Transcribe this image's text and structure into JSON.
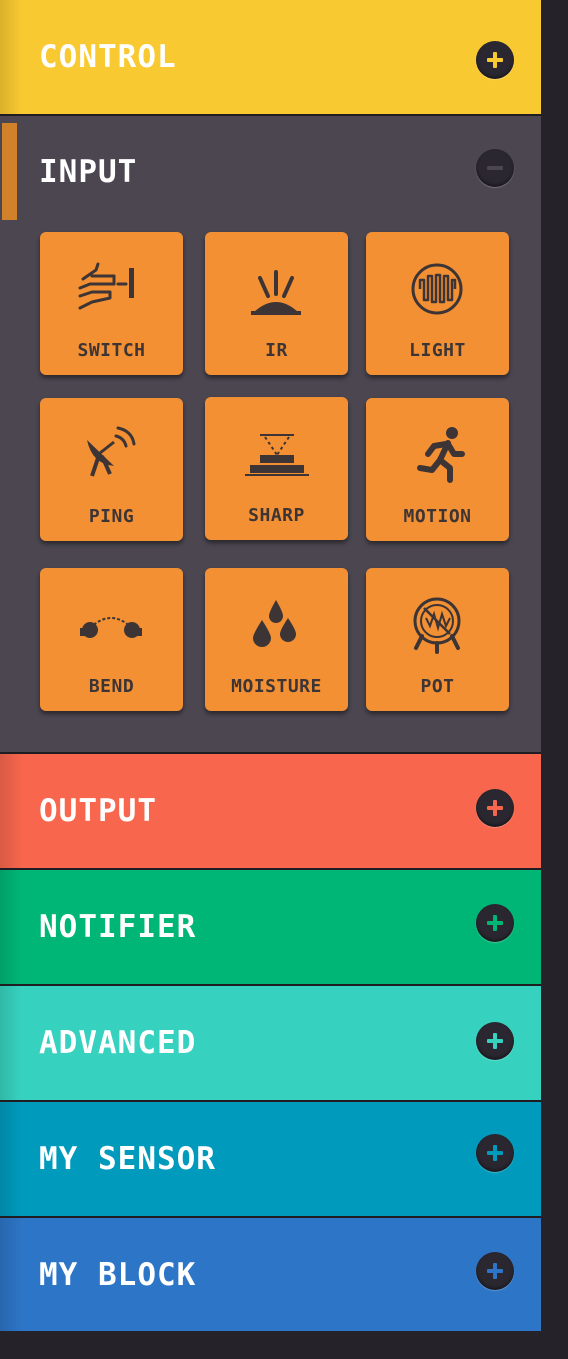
{
  "categories": {
    "control": {
      "label": "CONTROL",
      "color": "#f9c932",
      "toggle": "plus"
    },
    "input": {
      "label": "INPUT",
      "color": "#4b4650",
      "toggle": "minus"
    },
    "output": {
      "label": "OUTPUT",
      "color": "#f7664d",
      "toggle": "plus"
    },
    "notifier": {
      "label": "NOTIFIER",
      "color": "#00b676",
      "toggle": "plus"
    },
    "advanced": {
      "label": "ADVANCED",
      "color": "#37d2bf",
      "toggle": "plus"
    },
    "my_sensor": {
      "label": "MY SENSOR",
      "color": "#009abd",
      "toggle": "plus"
    },
    "my_block": {
      "label": "MY BLOCK",
      "color": "#2d75c6",
      "toggle": "plus"
    }
  },
  "input_blocks": [
    {
      "label": "SWITCH",
      "icon": "switch-hand-icon"
    },
    {
      "label": "IR",
      "icon": "ir-sensor-icon"
    },
    {
      "label": "LIGHT",
      "icon": "light-sensor-icon"
    },
    {
      "label": "PING",
      "icon": "satellite-dish-icon"
    },
    {
      "label": "SHARP",
      "icon": "sharp-sensor-icon"
    },
    {
      "label": "MOTION",
      "icon": "running-person-icon"
    },
    {
      "label": "BEND",
      "icon": "bend-sensor-icon"
    },
    {
      "label": "MOISTURE",
      "icon": "water-drops-icon"
    },
    {
      "label": "POT",
      "icon": "potentiometer-icon"
    }
  ],
  "colors": {
    "tile": "#f39033",
    "tile_text": "#3d3535",
    "toggle_bg": "#2a2730",
    "active_marker": "#d0812a"
  }
}
